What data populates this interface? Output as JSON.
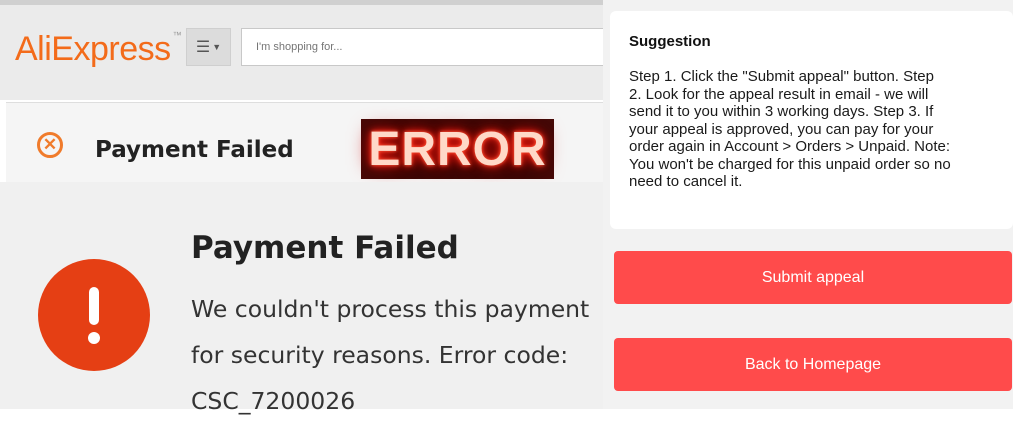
{
  "aliexpress_header": {
    "logo_text": "AliExpress",
    "logo_tm": "™",
    "menu_icon": "hamburger-menu-icon",
    "search_placeholder": "I'm shopping for...",
    "brand_color": "#f36b1a"
  },
  "ae_card": {
    "icon": "x-circle-icon",
    "title": "Payment Failed"
  },
  "error_sign": {
    "text": "ERROR"
  },
  "mobile_error": {
    "icon": "exclamation-circle-icon",
    "title": "Payment Failed",
    "message_lines": [
      "We couldn't process this payment",
      "for security reasons. Error code:",
      "CSC_7200026"
    ],
    "alert_color": "#e53f14"
  },
  "suggestion": {
    "title": "Suggestion",
    "body_lines": [
      "Step 1. Click the \"Submit appeal\" button. Step",
      "2. Look for the appeal result in email - we will",
      "send it to you within 3 working days. Step 3. If",
      "your appeal is approved, you can pay for your",
      "order again in Account > Orders > Unpaid. Note:",
      "You won't be charged for this unpaid order so no",
      "need to cancel it."
    ]
  },
  "buttons": {
    "submit_appeal": "Submit appeal",
    "back_home": "Back to Homepage",
    "color": "#ff4b4b"
  }
}
